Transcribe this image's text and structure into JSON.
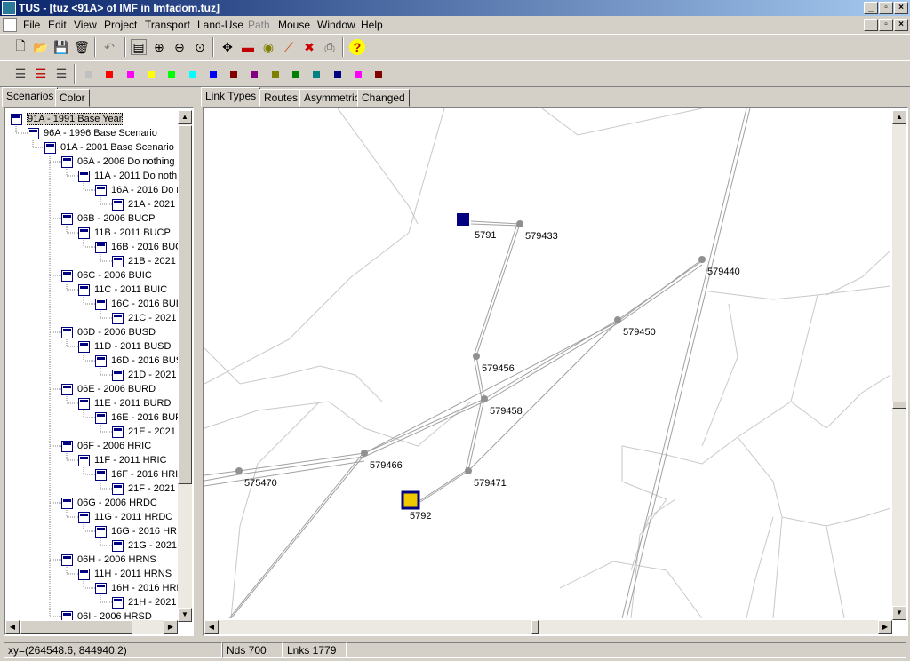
{
  "window": {
    "title": "TUS - [tuz <91A> of IMF in Imfadom.tuz]"
  },
  "menu": [
    "File",
    "Edit",
    "View",
    "Project",
    "Transport",
    "Land-Use",
    "Path",
    "Mouse",
    "Window",
    "Help"
  ],
  "menu_disabled": [
    "Path"
  ],
  "palette_colors": [
    "#c0c0c0",
    "#ff0000",
    "#ff00ff",
    "#ffff00",
    "#00ff00",
    "#00ffff",
    "#0000ff",
    "#800000",
    "#800080",
    "#808000",
    "#008000",
    "#008080",
    "#000080",
    "#ff00ff",
    "#800000"
  ],
  "left_tabs": [
    "Scenarios",
    "Color"
  ],
  "map_tabs": [
    "Link Types",
    "Routes",
    "Asymmetric",
    "Changed"
  ],
  "tree": [
    {
      "code": "91A",
      "desc": "- 1991 Base Year",
      "level": 0,
      "selected": true
    },
    {
      "code": "96A",
      "desc": "- 1996 Base Scenario",
      "level": 1
    },
    {
      "code": "01A",
      "desc": "- 2001 Base Scenario",
      "level": 2
    },
    {
      "code": "06A",
      "desc": "- 2006 Do nothing",
      "level": 3
    },
    {
      "code": "11A",
      "desc": "- 2011 Do noth",
      "level": 4
    },
    {
      "code": "16A",
      "desc": "- 2016 Do n",
      "level": 5
    },
    {
      "code": "21A",
      "desc": "- 2021",
      "level": 6
    },
    {
      "code": "06B",
      "desc": "- 2006 BUCP",
      "level": 3
    },
    {
      "code": "11B",
      "desc": "- 2011 BUCP",
      "level": 4
    },
    {
      "code": "16B",
      "desc": "- 2016 BUC",
      "level": 5
    },
    {
      "code": "21B",
      "desc": "- 2021",
      "level": 6
    },
    {
      "code": "06C",
      "desc": "- 2006 BUIC",
      "level": 3
    },
    {
      "code": "11C",
      "desc": "- 2011 BUIC",
      "level": 4
    },
    {
      "code": "16C",
      "desc": "- 2016 BUI",
      "level": 5
    },
    {
      "code": "21C",
      "desc": "- 2021",
      "level": 6
    },
    {
      "code": "06D",
      "desc": "- 2006 BUSD",
      "level": 3
    },
    {
      "code": "11D",
      "desc": "- 2011 BUSD",
      "level": 4
    },
    {
      "code": "16D",
      "desc": "- 2016 BUS",
      "level": 5
    },
    {
      "code": "21D",
      "desc": "- 2021",
      "level": 6
    },
    {
      "code": "06E",
      "desc": "- 2006 BURD",
      "level": 3
    },
    {
      "code": "11E",
      "desc": "- 2011 BURD",
      "level": 4
    },
    {
      "code": "16E",
      "desc": "- 2016 BUR",
      "level": 5
    },
    {
      "code": "21E",
      "desc": "- 2021",
      "level": 6
    },
    {
      "code": "06F",
      "desc": "- 2006 HRIC",
      "level": 3
    },
    {
      "code": "11F",
      "desc": "- 2011 HRIC",
      "level": 4
    },
    {
      "code": "16F",
      "desc": "- 2016 HRI",
      "level": 5
    },
    {
      "code": "21F",
      "desc": "- 2021",
      "level": 6
    },
    {
      "code": "06G",
      "desc": "- 2006 HRDC",
      "level": 3
    },
    {
      "code": "11G",
      "desc": "- 2011 HRDC",
      "level": 4
    },
    {
      "code": "16G",
      "desc": "- 2016 HRI",
      "level": 5
    },
    {
      "code": "21G",
      "desc": "- 2021",
      "level": 6
    },
    {
      "code": "06H",
      "desc": "- 2006 HRNS",
      "level": 3
    },
    {
      "code": "11H",
      "desc": "- 2011 HRNS",
      "level": 4
    },
    {
      "code": "16H",
      "desc": "- 2016 HRI",
      "level": 5
    },
    {
      "code": "21H",
      "desc": "- 2021",
      "level": 6
    },
    {
      "code": "06I",
      "desc": "- 2006 HRSD",
      "level": 3
    }
  ],
  "map": {
    "zones": [
      {
        "id": "5791",
        "color": "#000080"
      },
      {
        "id": "5792",
        "color": "#f0c800"
      }
    ],
    "nodes": [
      "579433",
      "579440",
      "579450",
      "579456",
      "579458",
      "579466",
      "579471",
      "575470"
    ]
  },
  "status": {
    "coords": "xy=(264548.6, 844940.2)",
    "nodes": "Nds 700",
    "links": "Lnks 1779"
  }
}
